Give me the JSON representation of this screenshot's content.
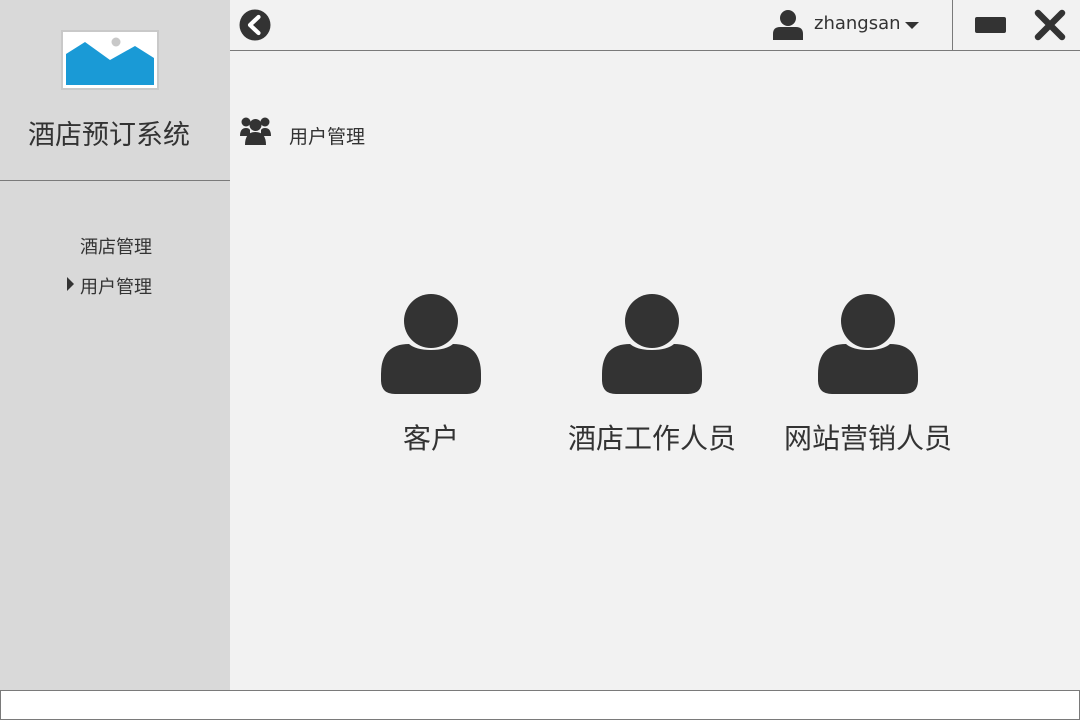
{
  "app": {
    "title": "酒店预订系统",
    "logo_icon": "image-placeholder-icon"
  },
  "sidebar": {
    "items": [
      {
        "label": "酒店管理",
        "active": false
      },
      {
        "label": "用户管理",
        "active": true
      }
    ]
  },
  "topbar": {
    "back_icon": "chevron-left-circle-icon",
    "username": "zhangsan",
    "user_icon": "user-icon",
    "dropdown_icon": "caret-down-icon",
    "minimize_icon": "minimize-icon",
    "close_icon": "close-icon"
  },
  "section": {
    "icon": "users-group-icon",
    "title": "用户管理"
  },
  "cards": [
    {
      "label": "客户",
      "icon": "user-icon"
    },
    {
      "label": "酒店工作人员",
      "icon": "user-icon"
    },
    {
      "label": "网站营销人员",
      "icon": "user-icon"
    }
  ],
  "colors": {
    "sidebar_bg": "#d9d9d9",
    "content_bg": "#f2f2f2",
    "icon_dark": "#333333",
    "logo_blue": "#1a9ad6"
  }
}
